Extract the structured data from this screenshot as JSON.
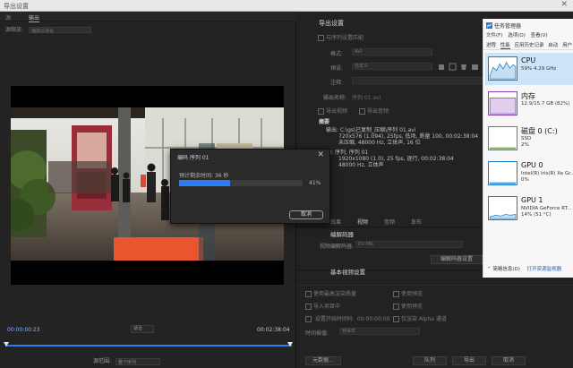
{
  "window": {
    "title": "导出设置"
  },
  "source_tabs": [
    "源",
    "输出"
  ],
  "source_scaling": {
    "label": "源缩放:",
    "value": "缩放以适合"
  },
  "playback": {
    "current_tc": "00:00:00:23",
    "end_tc": "00:02:38:04",
    "fit": "适合",
    "range_label": "源范围:",
    "range_value": "整个序列"
  },
  "export_settings": {
    "heading": "导出设置",
    "match_sequence": "与序列设置匹配",
    "format_label": "格式:",
    "format_value": "AVI",
    "preset_label": "预设:",
    "preset_value": "自定义",
    "comment_label": "注释:",
    "output_name_label": "输出名称:",
    "output_name_value": "序列 01.avi",
    "export_video": "导出视频",
    "export_audio": "导出音频"
  },
  "summary": {
    "heading": "摘要",
    "output_label": "输出:",
    "output_line1": "C:\\gs\\已复制_压缩\\序列 01.avi",
    "output_line2": "720x576 (1.094), 25fps, 低场, 质量 100, 00:02:38:04",
    "output_line3": "未压缩, 48000 Hz, 立体声, 16 位",
    "source_label": "源:",
    "source_line1": "序列, 序列 01",
    "source_line2": "1920x1080 (1.0), 25 fps, 逐行, 00:02:38:04",
    "source_line3": "48000 Hz, 立体声"
  },
  "tabs": [
    "效果",
    "视频",
    "音频",
    "发布"
  ],
  "codec": {
    "heading": "编解码器",
    "video_codec_label": "视频编解码器:",
    "video_codec_value": "DV PAL",
    "settings_button": "编解码器设置"
  },
  "basic_video": {
    "heading": "基本视频设置"
  },
  "bottom_options": {
    "max_render_quality": "使用最高渲染质量",
    "use_previews": "使用预览",
    "import_into_project": "导入项目中",
    "set_start_tc": "设置开始时间码",
    "start_tc_value": "00:00:00:00",
    "render_alpha": "仅渲染 Alpha 通道",
    "time_interp_label": "时间插值:",
    "time_interp_value": "帧采样"
  },
  "bottom_buttons": [
    "元数据...",
    "队列",
    "导出",
    "取消"
  ],
  "progress_dialog": {
    "title": "编码 序列 01",
    "remaining": "预计剩余时间: 36 秒",
    "progress": 0.41,
    "percent_text": "41%",
    "cancel": "取消"
  },
  "task_manager": {
    "title": "任务管理器",
    "menus": [
      "文件(F)",
      "选项(O)",
      "查看(V)"
    ],
    "tabs": [
      "进程",
      "性能",
      "应用历史记录",
      "启动",
      "用户"
    ],
    "active_tab": "性能",
    "resources": [
      {
        "name": "CPU",
        "d1": "59% 4.29 GHz",
        "d2": "",
        "color": "#1a7dc8",
        "selected": true
      },
      {
        "name": "内存",
        "d1": "12.9/15.7 GB (82%)",
        "d2": "",
        "color": "#8b3fbf",
        "selected": false
      },
      {
        "name": "磁盘 0 (C:)",
        "d1": "SSD",
        "d2": "2%",
        "color": "#4c9a2a",
        "selected": false
      },
      {
        "name": "GPU 0",
        "d1": "Intel(R) Iris(R) Xe Gr...",
        "d2": "0%",
        "color": "#1a7dc8",
        "selected": false
      },
      {
        "name": "GPU 1",
        "d1": "NVIDIA GeForce RT...",
        "d2": "14% (51 °C)",
        "color": "#1a7dc8",
        "selected": false
      }
    ],
    "footer_brief": "简略信息(D)",
    "footer_link": "打开资源监视器"
  }
}
